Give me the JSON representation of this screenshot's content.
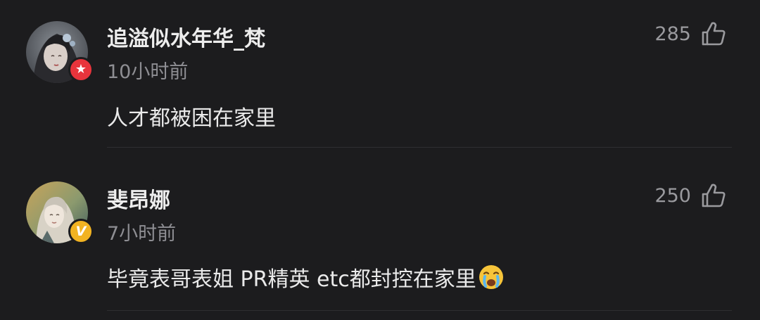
{
  "comments": [
    {
      "username": "追溢似水年华_梵",
      "time": "10小时前",
      "text": "人才都被困在家里",
      "likes": "285",
      "badge": "★",
      "badge_color": "#e8343c",
      "avatar_icon": "avatar-illustrated-girl"
    },
    {
      "username": "斐昂娜",
      "time": "7小时前",
      "text": "毕竟表哥表姐 PR精英 etc都封控在家里",
      "likes": "250",
      "badge": "V",
      "badge_color": "#f2b322",
      "avatar_icon": "avatar-illustrated-portrait",
      "emoji": "crying-face-emoji"
    }
  ],
  "colors": {
    "background": "#1c1c1e",
    "primary_text": "#eaeaea",
    "secondary_text": "#8e8e93",
    "divider": "#2e2e31"
  }
}
